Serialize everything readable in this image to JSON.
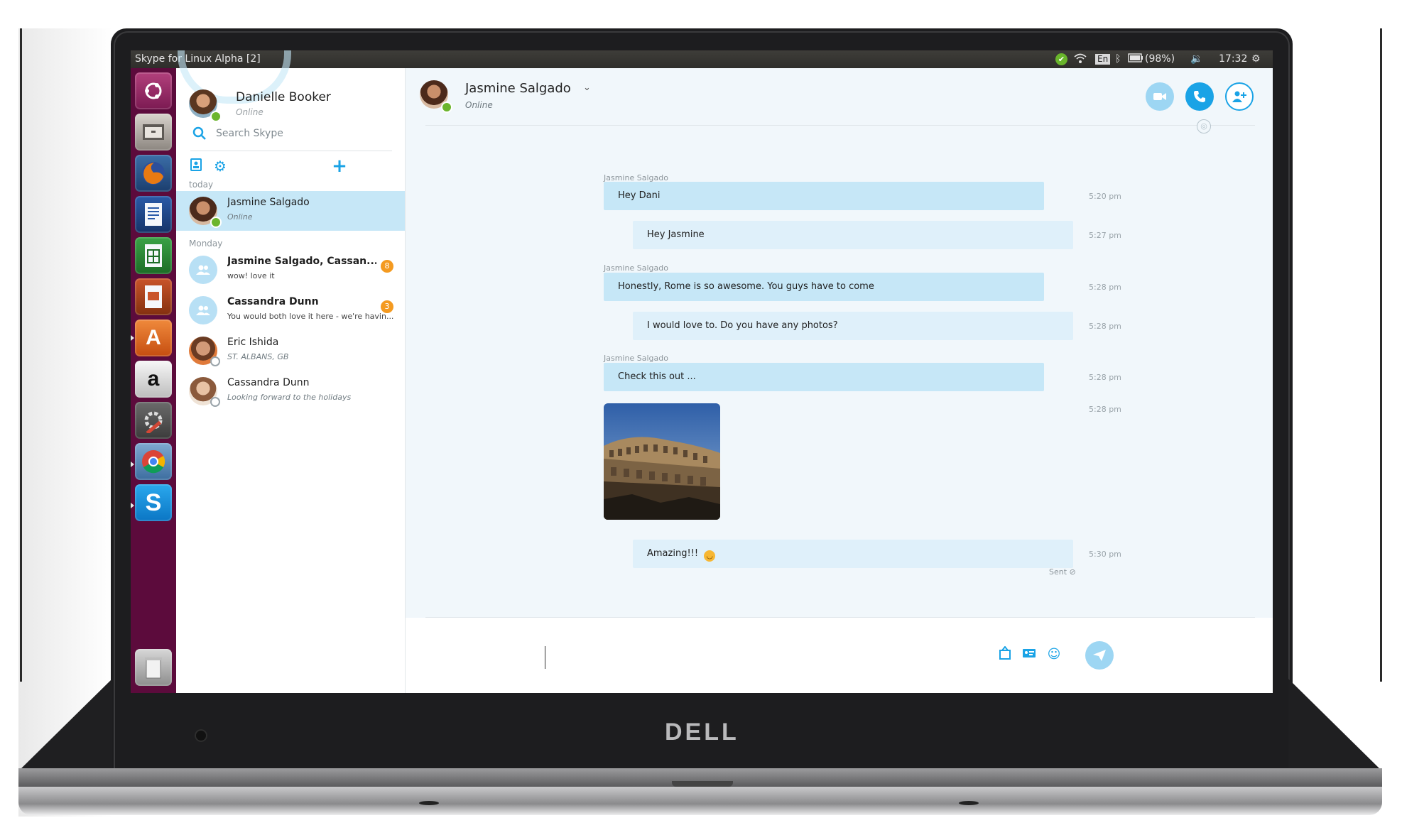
{
  "window": {
    "title": "Skype for Linux Alpha [2]"
  },
  "panel": {
    "battery": "(98%)",
    "clock": "17:32",
    "keyboard": "En",
    "icons": [
      "skype-status-icon",
      "wifi-icon",
      "keyboard-icon",
      "bluetooth-icon",
      "battery-icon",
      "volume-icon",
      "settings-icon"
    ]
  },
  "launcher": {
    "icons": [
      "ubuntu-dash-icon",
      "files-icon",
      "firefox-icon",
      "writer-icon",
      "calc-icon",
      "impress-icon",
      "software-center-icon",
      "amazon-icon",
      "system-settings-icon",
      "chrome-icon",
      "skype-icon",
      "trash-icon"
    ]
  },
  "profile": {
    "name": "Danielle Booker",
    "status": "Online"
  },
  "search": {
    "placeholder": "Search Skype"
  },
  "sections": {
    "today": "today",
    "monday": "Monday"
  },
  "conversations": [
    {
      "name": "Jasmine Salgado",
      "subtitle": "Online",
      "active": true
    },
    {
      "name": "Jasmine Salgado, Cassan...",
      "subtitle": "wow! love it",
      "badge": "8"
    },
    {
      "name": "Cassandra Dunn",
      "subtitle": "You would both love it here - we're havin...",
      "badge": "3"
    },
    {
      "name": "Eric Ishida",
      "subtitle": "ST. ALBANS, GB"
    },
    {
      "name": "Cassandra Dunn",
      "subtitle": "Looking forward to the holidays"
    }
  ],
  "chat": {
    "contact_name": "Jasmine Salgado",
    "contact_status": "Online",
    "messages": [
      {
        "sender": "Jasmine Salgado",
        "text": "Hey Dani",
        "time": "5:20 pm",
        "direction": "in"
      },
      {
        "text": "Hey Jasmine",
        "time": "5:27 pm",
        "direction": "out"
      },
      {
        "sender": "Jasmine Salgado",
        "text": "Honestly, Rome is so awesome. You guys have to come",
        "time": "5:28 pm",
        "direction": "in"
      },
      {
        "text": "I would love to. Do you have any photos?",
        "time": "5:28 pm",
        "direction": "out"
      },
      {
        "sender": "Jasmine Salgado",
        "text": "Check this out ...",
        "time": "5:28 pm",
        "direction": "in"
      },
      {
        "type": "photo",
        "time": "5:28 pm",
        "direction": "in"
      },
      {
        "text": "Amazing!!!",
        "emoji": "smile-emoji",
        "time": "5:30 pm",
        "direction": "out"
      }
    ],
    "sent_label": "Sent"
  },
  "composer": {
    "value": ""
  },
  "brand": {
    "laptop_logo": "DELL"
  },
  "colors": {
    "accent": "#1aa3e6",
    "launcher": "#5c0b3c",
    "active_row": "#c6e7f7",
    "badge": "#f49a20",
    "online": "#6bb52d"
  }
}
